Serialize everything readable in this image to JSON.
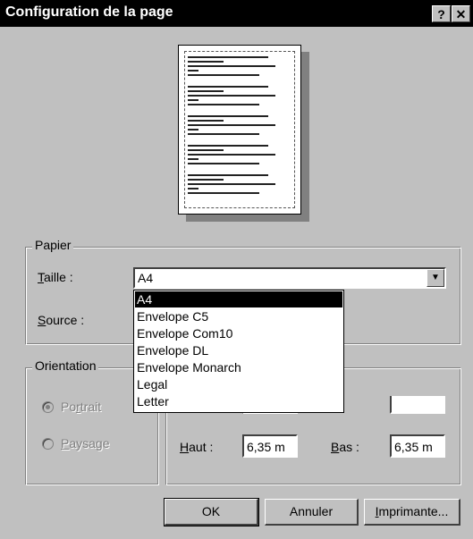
{
  "window": {
    "title": "Configuration de la page",
    "help_button": "?",
    "close_button": "✕"
  },
  "paper": {
    "group_label": "Papier",
    "size_label": "Taille :",
    "size_value": "A4",
    "source_label": "Source :",
    "size_options": [
      "A4",
      "Envelope C5",
      "Envelope Com10",
      "Envelope DL",
      "Envelope Monarch",
      "Legal",
      "Letter"
    ],
    "selected_option": "A4"
  },
  "orientation": {
    "group_label": "Orientation",
    "portrait_label": "Portrait",
    "landscape_label": "Paysage",
    "selected": "Portrait"
  },
  "margins": {
    "top_label": "Haut :",
    "top_value": "6,35 m",
    "bottom_label": "Bas :",
    "bottom_value": "6,35 m"
  },
  "buttons": {
    "ok": "OK",
    "cancel": "Annuler",
    "printer": "Imprimante..."
  },
  "icons": {
    "dropdown_arrow": "chevron-down-icon",
    "page_preview": "page-preview-icon"
  }
}
